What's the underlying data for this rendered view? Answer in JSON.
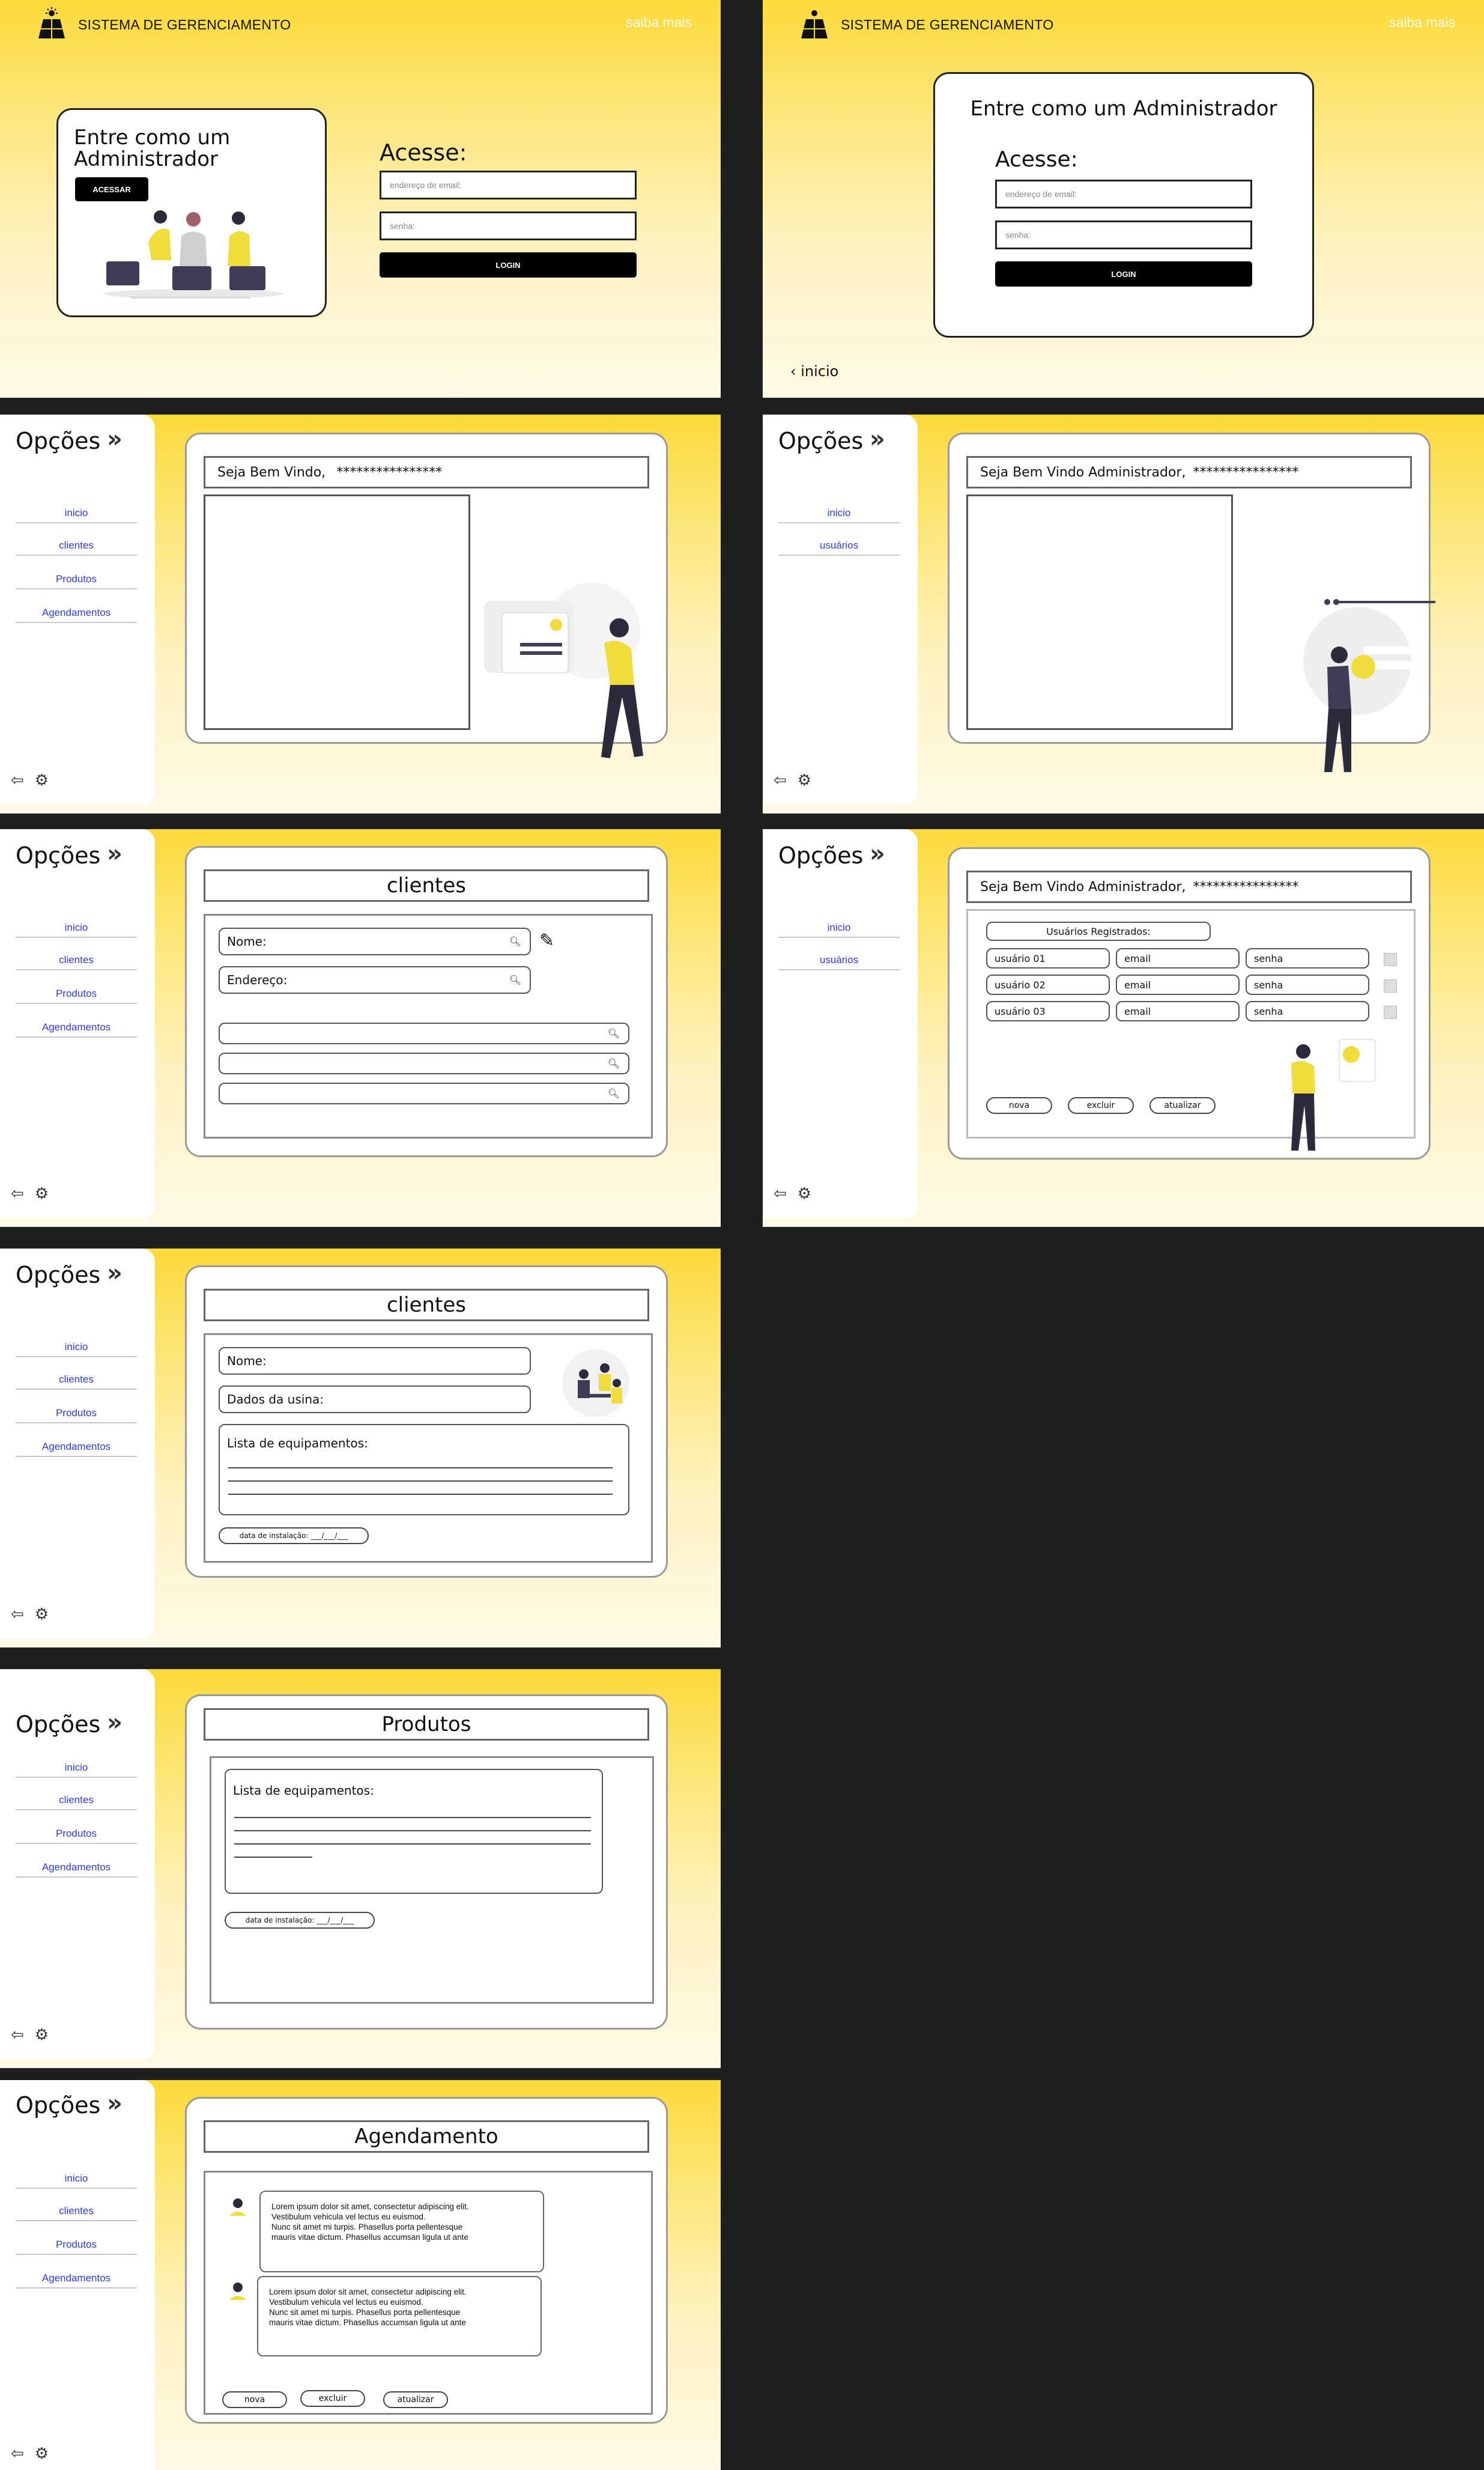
{
  "header": {
    "title": "SISTEMA DE GERENCIAMENTO",
    "link": "saiba mais"
  },
  "login1": {
    "card_title": "Entre como um Administrador",
    "access_button": "ACESSAR",
    "heading": "Acesse:",
    "email_placeholder": "endereço de email:",
    "password_placeholder": "senha:",
    "login_button": "LOGIN"
  },
  "login2": {
    "card_title": "Entre como um Administrador",
    "heading": "Acesse:",
    "email_placeholder": "endereço de email:",
    "password_placeholder": "senha:",
    "login_button": "LOGIN",
    "back_link": "inicio"
  },
  "sidebar": {
    "title": "Opções",
    "items_full": [
      "inicio",
      "clientes",
      "Produtos",
      "Agendamentos"
    ],
    "items_admin": [
      "inicio",
      "usuários"
    ]
  },
  "home_user": {
    "welcome": "Seja Bem Vindo,",
    "masked": "****************"
  },
  "home_admin": {
    "welcome": "Seja Bem Vindo Administrador,",
    "masked": "****************"
  },
  "clientes_search": {
    "title": "clientes",
    "name_label": "Nome:",
    "address_label": "Endereço:"
  },
  "users_admin": {
    "welcome": "Seja Bem Vindo Administrador,",
    "masked": "****************",
    "list_title": "Usuários Registrados:",
    "rows": [
      {
        "user": "usuário 01",
        "email": "email",
        "pass": "senha"
      },
      {
        "user": "usuário 02",
        "email": "email",
        "pass": "senha"
      },
      {
        "user": "usuário 03",
        "email": "email",
        "pass": "senha"
      }
    ],
    "buttons": [
      "nova",
      "excluir",
      "atualizar"
    ]
  },
  "clientes_form": {
    "title": "clientes",
    "name_label": "Nome:",
    "usina_label": "Dados da usina:",
    "equip_label": "Lista de equipamentos:",
    "date_label": "data de instalação:  ___/___/___"
  },
  "produtos": {
    "title": "Produtos",
    "equip_label": "Lista de equipamentos:",
    "date_label": "data de instalação:  ___/___/___"
  },
  "agendamento": {
    "title": "Agendamento",
    "messages": [
      "Lorem ipsum dolor sit amet, consectetur adipiscing elit.\n Vestibulum vehicula vel lectus eu euismod.\nNunc sit amet mi turpis. Phasellus porta pellentesque\n mauris vitae dictum. Phasellus accumsan ligula ut ante",
      "Lorem ipsum dolor sit amet, consectetur adipiscing elit.\n Vestibulum vehicula vel lectus eu euismod.\nNunc sit amet mi turpis. Phasellus porta pellentesque\n mauris vitae dictum. Phasellus accumsan ligula ut ante"
    ],
    "buttons": [
      "nova",
      "excluir",
      "atualizar"
    ]
  },
  "colors": {
    "accent_yellow": "#fcd93a",
    "link_blue": "#2f3bdc",
    "dark_bg": "#1f1f1f"
  },
  "icons": [
    "solar-panel-logo-icon",
    "chevrons-right-icon",
    "logout-icon",
    "gear-icon",
    "search-icon",
    "edit-icon",
    "chevron-left-icon"
  ]
}
